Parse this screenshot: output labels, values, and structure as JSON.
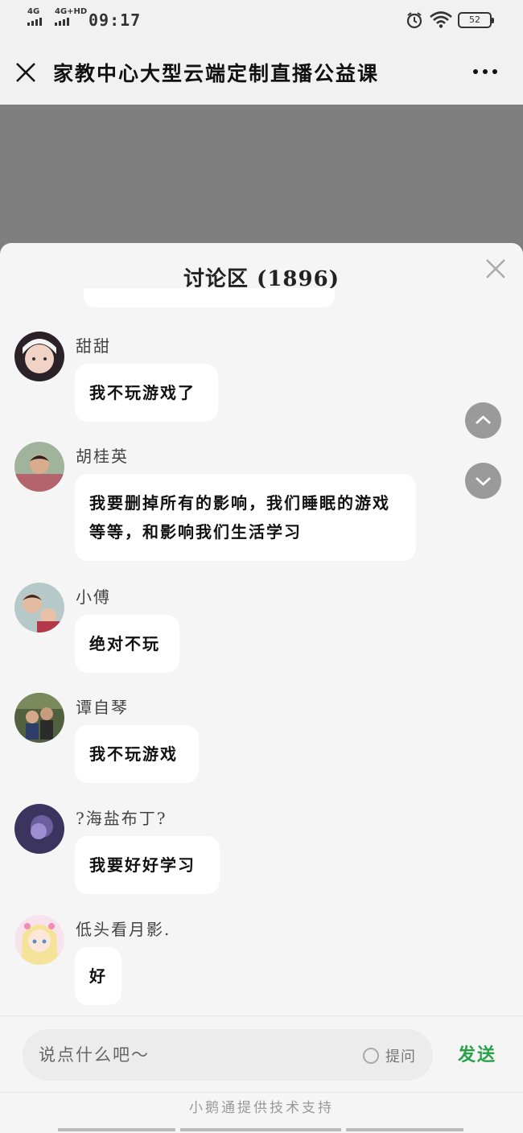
{
  "status_bar": {
    "signal1_label": "4G",
    "signal2_label": "4G+HD",
    "time": "09:17",
    "battery": "52"
  },
  "nav": {
    "title": "家教中心大型云端定制直播公益课"
  },
  "panel": {
    "title": "讨论区 (1896)"
  },
  "messages": [
    {
      "name": "甜甜",
      "text": "我不玩游戏了",
      "avatar_color": "#c9a7a0"
    },
    {
      "name": "胡桂英",
      "text": "我要删掉所有的影响，我们睡眠的游戏等等，和影响我们生活学习",
      "avatar_color": "#b88f7a"
    },
    {
      "name": "小傅",
      "text": "绝对不玩",
      "avatar_color": "#d6b59a"
    },
    {
      "name": "谭自琴",
      "text": "我不玩游戏",
      "avatar_color": "#6f7b5c"
    },
    {
      "name": "?海盐布丁?",
      "text": "我要好好学习",
      "avatar_color": "#4a4570"
    },
    {
      "name": "低头看月影.",
      "text": "好",
      "avatar_color": "#f0d0e0"
    }
  ],
  "input": {
    "placeholder": "说点什么吧～",
    "ask_label": "提问",
    "send_label": "发送"
  },
  "footer": {
    "text": "小鹅通提供技术支持"
  },
  "colors": {
    "send_green": "#2aa24a",
    "overlay_gray": "#7f7f7f"
  }
}
